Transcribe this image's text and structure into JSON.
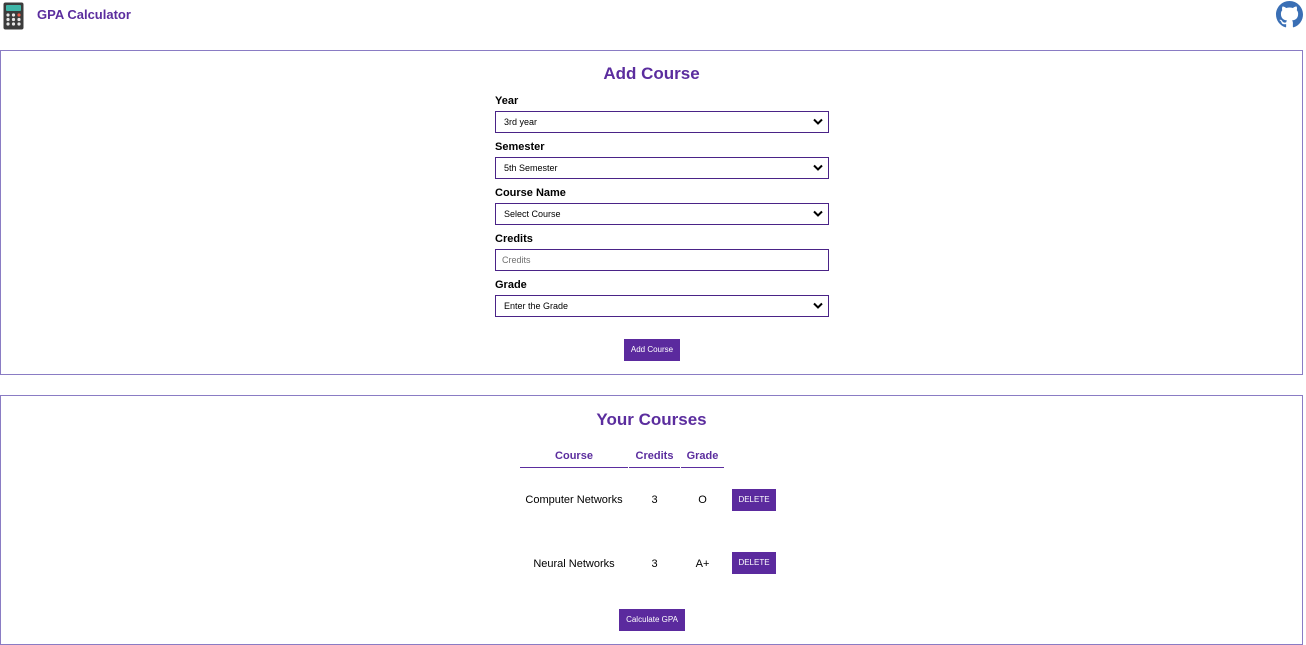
{
  "header": {
    "app_title": "GPA Calculator",
    "logo_icon": "calculator-icon",
    "github_icon": "github-icon"
  },
  "add_course": {
    "title": "Add Course",
    "year": {
      "label": "Year",
      "value": "3rd year"
    },
    "semester": {
      "label": "Semester",
      "value": "5th Semester"
    },
    "course_name": {
      "label": "Course Name",
      "value": "Select Course"
    },
    "credits": {
      "label": "Credits",
      "placeholder": "Credits"
    },
    "grade": {
      "label": "Grade",
      "value": "Enter the Grade"
    },
    "submit_label": "Add Course"
  },
  "your_courses": {
    "title": "Your Courses",
    "headers": [
      "Course",
      "Credits",
      "Grade"
    ],
    "rows": [
      {
        "course": "Computer Networks",
        "credits": "3",
        "grade": "O",
        "action": "DELETE"
      },
      {
        "course": "Neural Networks",
        "credits": "3",
        "grade": "A+",
        "action": "DELETE"
      }
    ],
    "calculate_label": "Calculate GPA"
  },
  "colors": {
    "accent": "#5b2a9e",
    "border": "#8a7cc4"
  }
}
